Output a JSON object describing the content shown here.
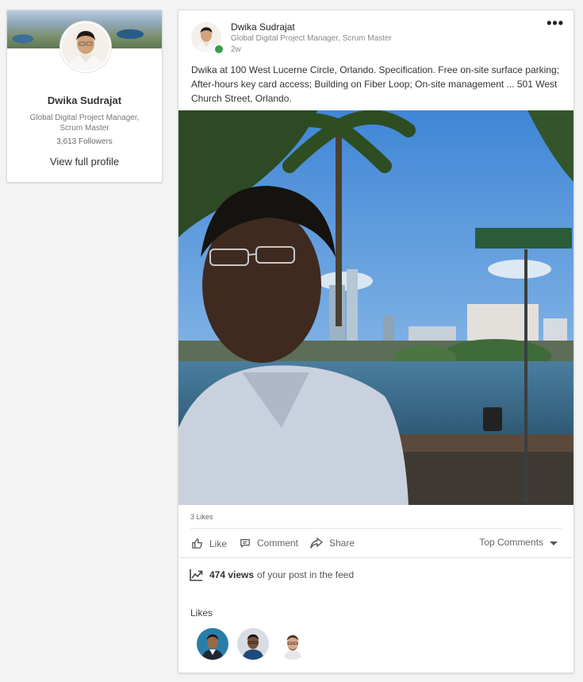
{
  "profile": {
    "name": "Dwika Sudrajat",
    "headline": "Global Digital Project Manager, Scrum Master",
    "followers": "3,613 Followers",
    "view_profile": "View full profile"
  },
  "post": {
    "author_name": "Dwika Sudrajat",
    "author_headline": "Global Digital Project Manager, Scrum Master",
    "time": "2w",
    "more_icon": "more-dots-icon",
    "text": "Dwika at 100 West Lucerne Circle, Orlando. Specification. Free on-site surface parking; After-hours key card access; Building on Fiber Loop; On-site management ... 501 West Church Street, Orlando.",
    "likes_count": "3 Likes",
    "presence_color": "#3a9d4b"
  },
  "actions": {
    "like": "Like",
    "comment": "Comment",
    "share": "Share",
    "sort": "Top Comments"
  },
  "analytics": {
    "views": "474 views",
    "views_suffix": "of your post in the feed"
  },
  "likes_section": {
    "title": "Likes"
  }
}
